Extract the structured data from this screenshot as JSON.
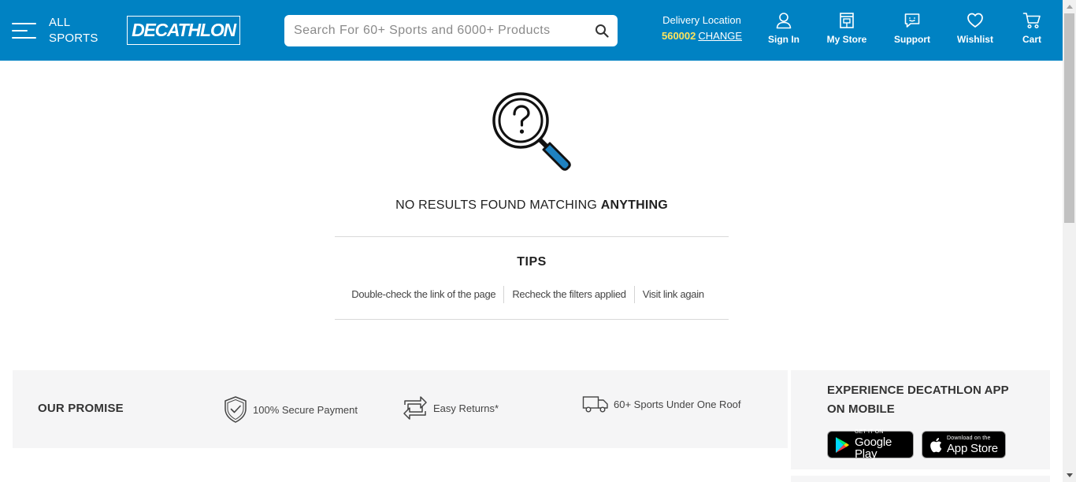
{
  "header": {
    "menu_label_line1": "ALL",
    "menu_label_line2": "SPORTS",
    "logo_text": "DECATHLON",
    "search_placeholder": "Search For 60+ Sports and 6000+ Products",
    "delivery_title": "Delivery Location",
    "delivery_pincode": "560002",
    "delivery_change": "CHANGE",
    "nav": {
      "sign_in": "Sign In",
      "my_store": "My Store",
      "support": "Support",
      "wishlist": "Wishlist",
      "cart": "Cart"
    }
  },
  "main": {
    "no_results_prefix": "NO RESULTS FOUND MATCHING ",
    "no_results_term": "ANYTHING",
    "tips_title": "TIPS",
    "tips": [
      "Double-check the link of the page",
      "Recheck the filters applied",
      "Visit link again"
    ]
  },
  "promise": {
    "title": "OUR PROMISE",
    "items": [
      "100% Secure Payment",
      "Easy Returns*",
      "60+ Sports Under One Roof"
    ]
  },
  "app": {
    "title": "EXPERIENCE DECATHLON APP ON MOBILE",
    "google_play_small": "GET IT ON",
    "google_play_big": "Google Play",
    "app_store_small": "Download on the",
    "app_store_big": "App Store"
  },
  "colors": {
    "brand_blue": "#0082c3",
    "pincode_yellow": "#ffe45c",
    "panel_grey": "#f5f5f6"
  }
}
